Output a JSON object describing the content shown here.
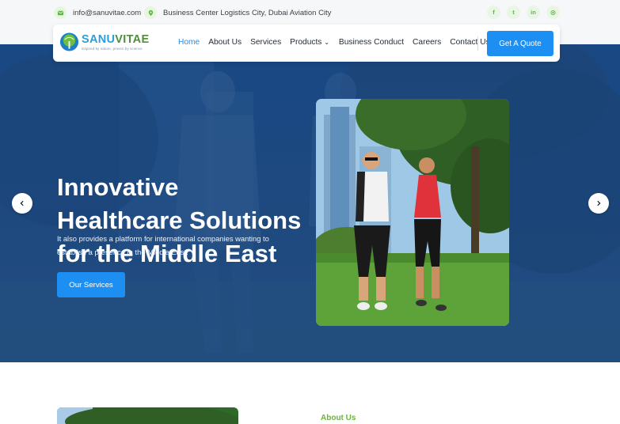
{
  "topbar": {
    "email": "info@sanuvitae.com",
    "address": "Business Center Logistics City, Dubai Aviation City",
    "socials": [
      {
        "icon": "facebook-icon",
        "glyph": "f"
      },
      {
        "icon": "twitter-icon",
        "glyph": "t"
      },
      {
        "icon": "linkedin-icon",
        "glyph": "in"
      },
      {
        "icon": "instagram-icon",
        "glyph": "◎"
      }
    ]
  },
  "nav": {
    "brand_part1": "SANU",
    "brand_part2": "VITAE",
    "tagline": "inspired by nature, proven by science",
    "items": [
      "Home",
      "About Us",
      "Services",
      "Products",
      "Business Conduct",
      "Careers",
      "Contact Us"
    ],
    "products_caret": "⌄",
    "cta": "Get A Quote"
  },
  "hero": {
    "headline_line1": "Innovative",
    "headline_line2": "Healthcare Solutions",
    "headline_line3": "for the Middle East",
    "subtext": "It also provides a platform for international companies wanting to establish a presence in the Middle East.",
    "button": "Our Services"
  },
  "about": {
    "label": "About Us"
  },
  "colors": {
    "accent": "#1e8ff2",
    "brand_blue": "#2c9fd8",
    "brand_green": "#4e8f3a",
    "hero_bg": "#1c4e89",
    "label_green": "#6cb33f"
  }
}
